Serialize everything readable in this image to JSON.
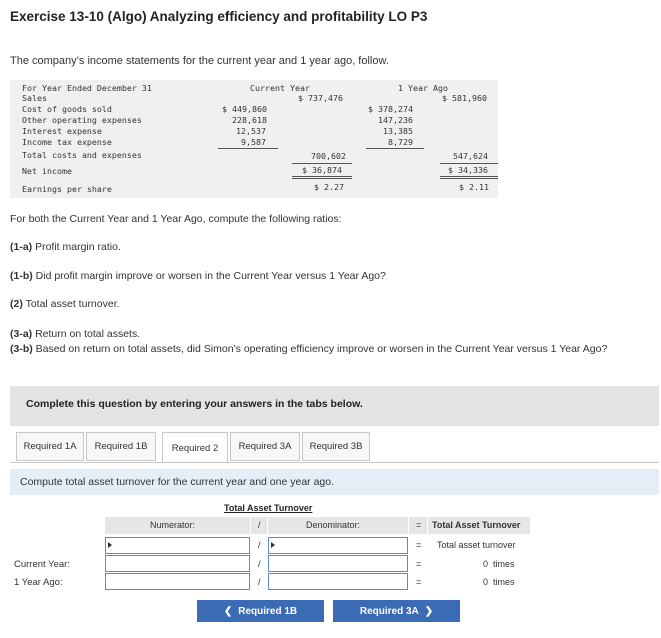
{
  "title": "Exercise 13-10 (Algo) Analyzing efficiency and profitability LO P3",
  "intro": "The company’s income statements for the current year and 1 year ago, follow.",
  "statement": {
    "header_label": "For Year Ended December 31",
    "col_current": "Current Year",
    "col_ago": "1 Year Ago",
    "rows": {
      "sales": {
        "label": "Sales",
        "cur_total": "$ 737,476",
        "ago_total": "$ 581,960"
      },
      "cogs": {
        "label": "Cost of goods sold",
        "cur": "$ 449,860",
        "ago": "$ 378,274"
      },
      "opex": {
        "label": "Other operating expenses",
        "cur": "228,618",
        "ago": "147,236"
      },
      "interest": {
        "label": "Interest expense",
        "cur": "12,537",
        "ago": "13,385"
      },
      "tax": {
        "label": "Income tax expense",
        "cur": "9,587",
        "ago": "8,729"
      },
      "total": {
        "label": "Total costs and expenses",
        "cur_total": "700,602",
        "ago_total": "547,624"
      },
      "net": {
        "label": "Net income",
        "cur_total": "$ 36,874",
        "ago_total": "$ 34,336"
      },
      "eps": {
        "label": "Earnings per share",
        "cur_total": "$ 2.27",
        "ago_total": "$ 2.11"
      }
    }
  },
  "instructions": "For both the Current Year and 1 Year Ago, compute the following ratios:",
  "questions": [
    {
      "tag": "(1-a)",
      "text": " Profit margin ratio."
    },
    {
      "tag": "(1-b)",
      "text": " Did profit margin improve or worsen in the Current Year versus 1 Year Ago?"
    },
    {
      "tag": "(2)",
      "text": " Total asset turnover."
    },
    {
      "tag": "(3-a)",
      "text": " Return on total assets."
    },
    {
      "tag": "(3-b)",
      "text": " Based on return on total assets, did Simon’s operating efficiency improve or worsen in the Current Year versus 1 Year Ago?"
    }
  ],
  "banner": "Complete this question by entering your answers in the tabs below.",
  "tabs": [
    "Required 1A",
    "Required 1B",
    "Required 2",
    "Required 3A",
    "Required 3B"
  ],
  "panel_instruction": "Compute total asset turnover for the current year and one year ago.",
  "table": {
    "title": "Total Asset Turnover",
    "numerator_hdr": "Numerator:",
    "slash": "/",
    "denominator_hdr": "Denominator:",
    "eq": "=",
    "result_hdr": "Total Asset Turnover",
    "subhdr": "Total asset turnover",
    "row_current": "Current Year:",
    "row_ago": "1 Year Ago:",
    "current_result": "0",
    "ago_result": "0",
    "unit": "times"
  },
  "nav": {
    "prev": "Required 1B",
    "next": "Required 3A"
  },
  "colors": {
    "button": "#3b6bb4",
    "input_border": "#5b8cc7",
    "instr_bg": "#e3eef7"
  }
}
